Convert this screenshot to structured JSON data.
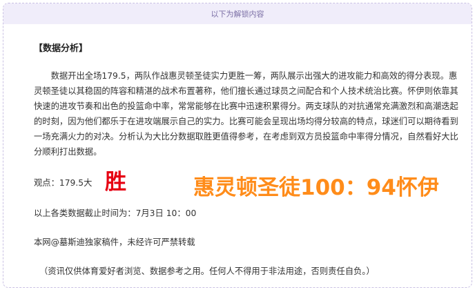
{
  "banner": {
    "text": "以下为解锁内容"
  },
  "analysis": {
    "title": "【数据分析】",
    "body": "数据开出全场179.5，两队作战惠灵顿圣徒实力更胜一筹，两队展示出强大的进攻能力和高效的得分表现。惠灵顿圣徒以其稳固的阵容和精湛的战术布置著称，他们擅长通过球员之间配合和个人技术统治比赛。怀伊则依靠其快速的进攻节奏和出色的投篮命中率，常常能够在比赛中迅速积累得分。两支球队的对抗通常充满激烈和高潮迭起的时刻，因为他们都乐于在进攻端展示自己的实力。比赛可能会呈现出场均得分较高的特点，球迷们可以期待看到一场充满火力的对决。分析认为大比分数据取胜更值得参考，在考虑到双方员投篮命中率得分情况，自然看好大比分顺利打出数据。"
  },
  "prediction": {
    "view_text": "观点：179.5大",
    "result_badge": "胜",
    "score_text": "惠灵顿圣徒100：94怀伊"
  },
  "footer": {
    "deadline": "以上各类数据截止时间为：7月3日 10：00",
    "copyright": "本网@墓斯迪独家稿件，未经许可严禁转载",
    "disclaimer": "（资讯仅供体育爱好者浏览、数据参考之用。任何人不得用于非法用途，否则责任自负。）"
  },
  "colors": {
    "banner_bg": "#f0edfa",
    "banner_text": "#7c70a6",
    "border": "#c9c0e3",
    "result_red": "#e60012",
    "score_orange": "#ff8c1a"
  }
}
